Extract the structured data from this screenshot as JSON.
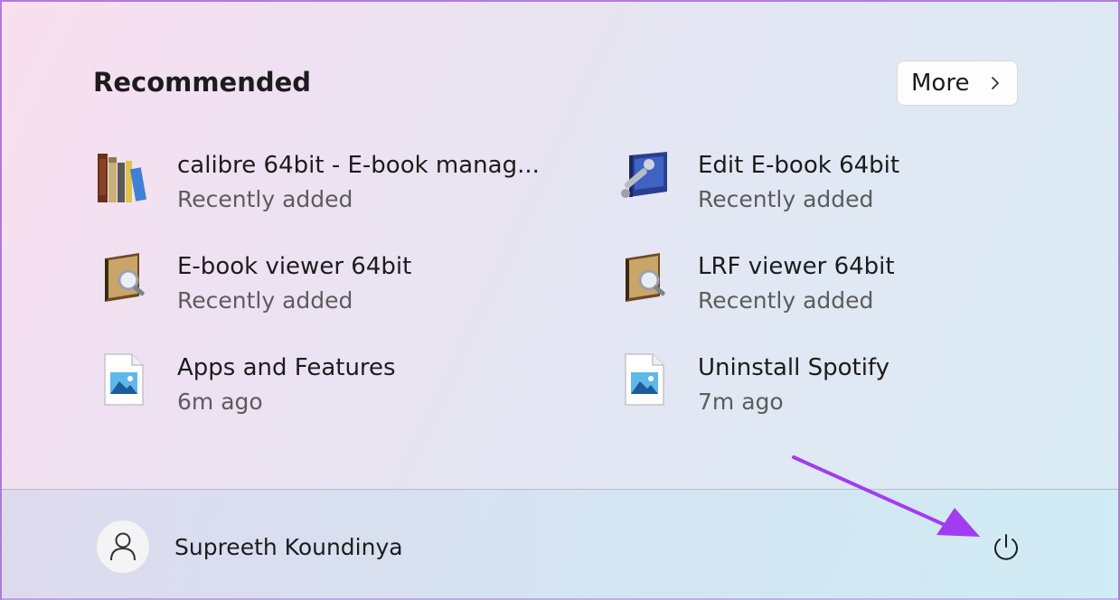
{
  "recommended": {
    "title": "Recommended",
    "more_label": "More",
    "items": [
      {
        "name": "calibre 64bit - E-book manag...",
        "sub": "Recently added",
        "icon": "calibre-books-icon"
      },
      {
        "name": "Edit E-book 64bit",
        "sub": "Recently added",
        "icon": "ebook-edit-icon"
      },
      {
        "name": "E-book viewer 64bit",
        "sub": "Recently added",
        "icon": "ebook-viewer-icon"
      },
      {
        "name": "LRF viewer 64bit",
        "sub": "Recently added",
        "icon": "lrf-viewer-icon"
      },
      {
        "name": "Apps and Features",
        "sub": "6m ago",
        "icon": "image-file-icon"
      },
      {
        "name": "Uninstall Spotify",
        "sub": "7m ago",
        "icon": "image-file-icon"
      }
    ]
  },
  "footer": {
    "user_name": "Supreeth Koundinya",
    "avatar_icon": "user-icon",
    "power_icon": "power-icon"
  },
  "colors": {
    "border": "#b07bd6",
    "annotation_arrow": "#a23cf0"
  }
}
